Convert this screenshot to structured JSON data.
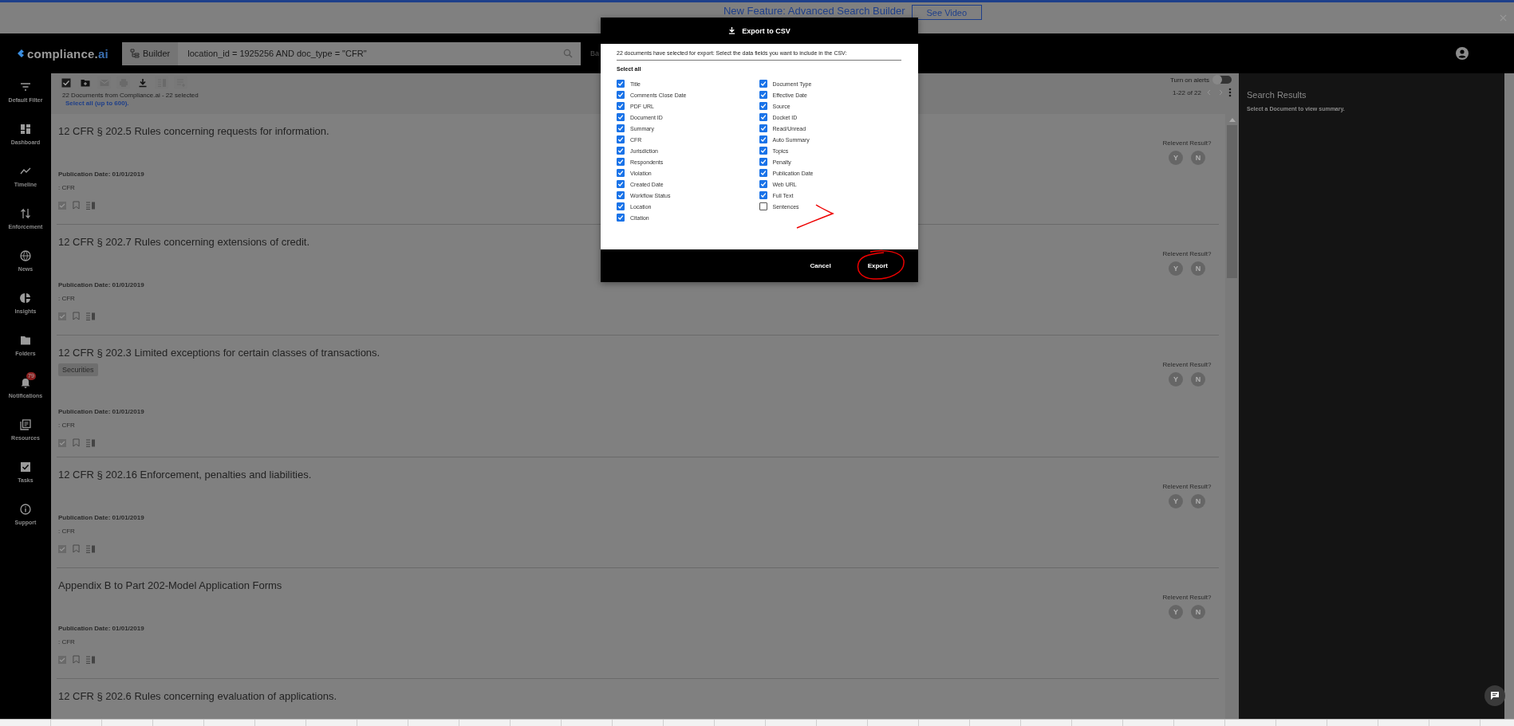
{
  "banner": {
    "text": "New Feature: Advanced Search Builder",
    "button": "See Video"
  },
  "header": {
    "logo": {
      "text": "compliance.",
      "accent": "ai"
    },
    "builder": "Builder",
    "query": "location_id = 1925256 AND doc_type = \"CFR\"",
    "basic_link": "Ba"
  },
  "sidebar": {
    "items": [
      {
        "kind": "filter",
        "label": "Default Filter"
      },
      {
        "kind": "dashboard",
        "label": "Dashboard"
      },
      {
        "kind": "timeline",
        "label": "Timeline"
      },
      {
        "kind": "enforcement",
        "label": "Enforcement"
      },
      {
        "kind": "globe",
        "label": "News"
      },
      {
        "kind": "pie",
        "label": "Insights"
      },
      {
        "kind": "folder",
        "label": "Folders"
      },
      {
        "kind": "bell",
        "label": "Notifications",
        "badge": "79"
      },
      {
        "kind": "library",
        "label": "Resources"
      },
      {
        "kind": "tasks",
        "label": "Tasks"
      },
      {
        "kind": "info",
        "label": "Support"
      }
    ]
  },
  "toolbar": {
    "buttons": [
      {
        "kind": "select",
        "disabled": false
      },
      {
        "kind": "folder",
        "disabled": false
      },
      {
        "kind": "mail",
        "disabled": true
      },
      {
        "kind": "print",
        "disabled": true
      },
      {
        "kind": "download",
        "disabled": false
      },
      {
        "kind": "columns",
        "disabled": true
      },
      {
        "kind": "add_list",
        "disabled": true
      }
    ],
    "summary": "22 Documents from Compliance.ai - 22 selected",
    "select_all_link": "Select all (up to 600).",
    "alerts": {
      "label": "Turn on alerts",
      "on": false
    },
    "pagination": "1-22 of 22"
  },
  "documents": [
    {
      "title": "12 CFR § 202.5 Rules concerning requests for information.",
      "pub_label": "Publication Date:",
      "pub_date": "01/01/2019",
      "source": ": CFR",
      "checked": true,
      "relevance": {
        "label": "Relevent Result?",
        "yes": "Y",
        "no": "N"
      }
    },
    {
      "title": "12 CFR § 202.7 Rules concerning extensions of credit.",
      "pub_label": "Publication Date:",
      "pub_date": "01/01/2019",
      "source": ": CFR",
      "checked": true,
      "relevance": {
        "label": "Relevent Result?",
        "yes": "Y",
        "no": "N"
      }
    },
    {
      "title": "12 CFR § 202.3 Limited exceptions for certain classes of transactions.",
      "tags": [
        "Securities"
      ],
      "pub_label": "Publication Date:",
      "pub_date": "01/01/2019",
      "source": ": CFR",
      "checked": true,
      "relevance": {
        "label": "Relevent Result?",
        "yes": "Y",
        "no": "N"
      }
    },
    {
      "title": "12 CFR § 202.16 Enforcement, penalties and liabilities.",
      "pub_label": "Publication Date:",
      "pub_date": "01/01/2019",
      "source": ": CFR",
      "checked": true,
      "relevance": {
        "label": "Relevent Result?",
        "yes": "Y",
        "no": "N"
      }
    },
    {
      "title": "Appendix B to Part 202-Model Application Forms",
      "pub_label": "Publication Date:",
      "pub_date": "01/01/2019",
      "source": ": CFR",
      "checked": true,
      "relevance": {
        "label": "Relevent Result?",
        "yes": "Y",
        "no": "N"
      }
    },
    {
      "title": "12 CFR § 202.6 Rules concerning evaluation of applications."
    }
  ],
  "summary_panel": {
    "title": "Search Results",
    "hint": "Select a Document to view summary."
  },
  "modal": {
    "title": "Export to CSV",
    "intro": "22 documents have selected for export: Select the data fields you want to include in the CSV:",
    "select_all": "Select all",
    "columns": [
      [
        {
          "label": "Title",
          "checked": true
        },
        {
          "label": "Comments Close Date",
          "checked": true
        },
        {
          "label": "PDF URL",
          "checked": true
        },
        {
          "label": "Document ID",
          "checked": true
        },
        {
          "label": "Summary",
          "checked": true
        },
        {
          "label": "CFR",
          "checked": true
        },
        {
          "label": "Jurisdiction",
          "checked": true
        },
        {
          "label": "Respondents",
          "checked": true
        },
        {
          "label": "Violation",
          "checked": true
        },
        {
          "label": "Created Date",
          "checked": true
        },
        {
          "label": "Workflow Status",
          "checked": true
        },
        {
          "label": "Location",
          "checked": true
        },
        {
          "label": "Citation",
          "checked": true
        }
      ],
      [
        {
          "label": "Document Type",
          "checked": true
        },
        {
          "label": "Effective Date",
          "checked": true
        },
        {
          "label": "Source",
          "checked": true
        },
        {
          "label": "Docket ID",
          "checked": true
        },
        {
          "label": "Read/Unread",
          "checked": true
        },
        {
          "label": "Auto Summary",
          "checked": true
        },
        {
          "label": "Topics",
          "checked": true
        },
        {
          "label": "Penalty",
          "checked": true
        },
        {
          "label": "Publication Date",
          "checked": true
        },
        {
          "label": "Web URL",
          "checked": true
        },
        {
          "label": "Full Text",
          "checked": true
        },
        {
          "label": "Sentences",
          "checked": false
        }
      ]
    ],
    "cancel": "Cancel",
    "export": "Export"
  }
}
